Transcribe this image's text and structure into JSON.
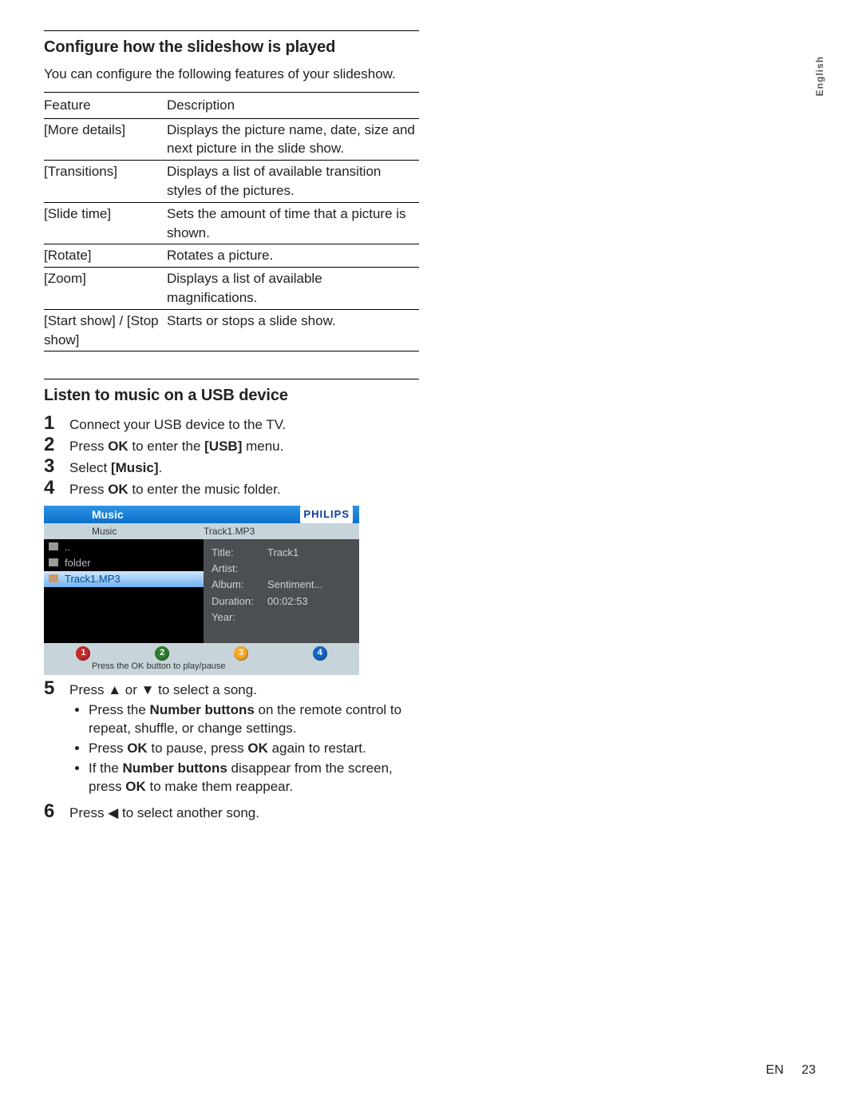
{
  "section1": {
    "heading": "Configure how the slideshow is played",
    "intro": "You can configure the following features of your slideshow.",
    "headers": {
      "feature": "Feature",
      "description": "Description"
    },
    "rows": [
      {
        "feature": "[More details]",
        "desc": "Displays the picture name, date, size and next picture in the slide show."
      },
      {
        "feature": "[Transitions]",
        "desc": "Displays a list of available transition styles of the pictures."
      },
      {
        "feature": "[Slide time]",
        "desc": "Sets the amount of time that a picture is shown."
      },
      {
        "feature": "[Rotate]",
        "desc": "Rotates a picture."
      },
      {
        "feature": "[Zoom]",
        "desc": "Displays a list of available magnifications."
      },
      {
        "feature": "[Start show] / [Stop show]",
        "desc": "Starts or stops a slide show."
      }
    ]
  },
  "section2": {
    "heading": "Listen to music on a USB device",
    "steps": {
      "s1": "Connect your USB device to the TV.",
      "s2_pre": "Press ",
      "s2_bold": "OK",
      "s2_mid": " to enter the ",
      "s2_bold2": "[USB]",
      "s2_post": " menu.",
      "s3_pre": "Select ",
      "s3_bold": "[Music]",
      "s3_post": ".",
      "s4_pre": "Press ",
      "s4_bold": "OK",
      "s4_post": " to enter the music folder.",
      "s5_pre": "Press ",
      "s5_up": "▲",
      "s5_mid": " or ",
      "s5_down": "▼",
      "s5_post": " to select a song.",
      "s5_bullets": {
        "b1_pre": "Press the ",
        "b1_bold": "Number buttons",
        "b1_post": " on the remote control to repeat, shuffle, or change settings.",
        "b2_pre": "Press ",
        "b2_bold": "OK",
        "b2_mid": " to pause, press ",
        "b2_bold2": "OK",
        "b2_post": " again to restart.",
        "b3_pre": "If the ",
        "b3_bold": "Number buttons",
        "b3_mid": " disappear from the screen, press ",
        "b3_bold2": "OK",
        "b3_post": " to make them reappear."
      },
      "s6_pre": "Press ",
      "s6_left": "◀",
      "s6_post": " to select another song."
    }
  },
  "tv": {
    "title": "Music",
    "brand": "PHILIPS",
    "crumb_left": "Music",
    "crumb_right": "Track1.MP3",
    "left_rows": {
      "r0": "..",
      "r1": "folder",
      "r2": "Track1.MP3"
    },
    "info": {
      "title_k": "Title:",
      "title_v": "Track1",
      "artist_k": "Artist:",
      "artist_v": "",
      "album_k": "Album:",
      "album_v": "Sentiment...",
      "duration_k": "Duration:",
      "duration_v": "00:02:53",
      "year_k": "Year:",
      "year_v": ""
    },
    "btns": {
      "b1": "1",
      "b2": "2",
      "b3": "3",
      "b4": "4"
    },
    "btn_colors": [
      "#c62828",
      "#2e7d32",
      "#f9a825",
      "#1565c0"
    ],
    "hint": "Press the OK button to play/pause"
  },
  "footer": {
    "lang": "EN",
    "page": "23"
  },
  "side_tab": "English"
}
